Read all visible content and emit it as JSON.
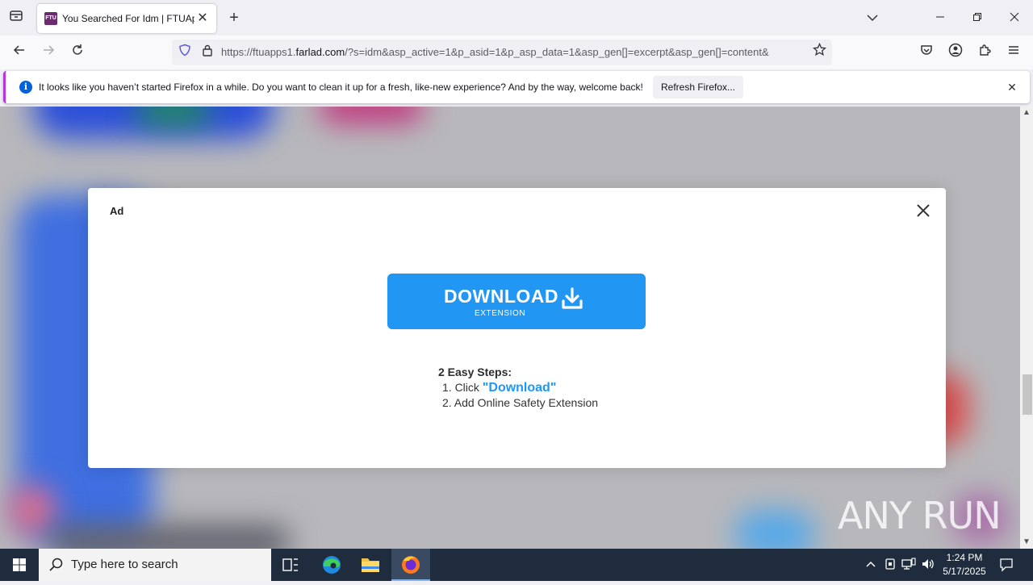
{
  "browser": {
    "tab": {
      "favicon_text": "FTU",
      "title": "You Searched For Idm | FTUApps"
    },
    "url": {
      "prefix": "https://ftuapps1.",
      "host": "farlad.com",
      "rest": "/?s=idm&asp_active=1&p_asid=1&p_asp_data=1&asp_gen[]=excerpt&asp_gen[]=content&"
    },
    "notification": {
      "message": "It looks like you haven’t started Firefox in a while. Do you want to clean it up for a fresh, like-new experience? And by the way, welcome back!",
      "button_label": "Refresh Firefox..."
    }
  },
  "modal": {
    "ad_label": "Ad",
    "download_button": {
      "main": "DOWNLOAD",
      "sub": "EXTENSION"
    },
    "steps_title": "2 Easy Steps:",
    "step1_prefix": "1. Click ",
    "step1_highlight": "\"Download\"",
    "step2": "2. Add Online Safety Extension"
  },
  "watermark": "ANY RUN",
  "taskbar": {
    "search_placeholder": "Type here to search",
    "time": "1:24 PM",
    "date": "5/17/2025"
  },
  "colors": {
    "accent_blue": "#2196f3",
    "taskbar": "#1f2c3e",
    "notification_accent": "#b833e1"
  }
}
